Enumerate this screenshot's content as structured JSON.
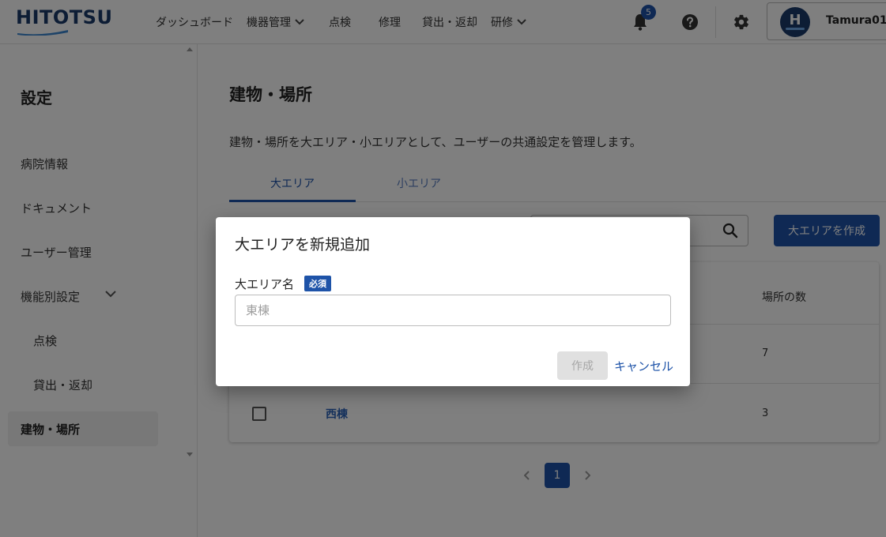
{
  "header": {
    "logo_text": "HITOTSU",
    "nav": [
      {
        "label": "ダッシュボード",
        "has_menu": false
      },
      {
        "label": "機器管理",
        "has_menu": true
      },
      {
        "label": "点検",
        "has_menu": false
      },
      {
        "label": "修理",
        "has_menu": false
      },
      {
        "label": "貸出・返却",
        "has_menu": false
      },
      {
        "label": "研修",
        "has_menu": true
      }
    ],
    "notification_count": "5",
    "user": {
      "avatar_letter": "H",
      "name": "Tamura01"
    },
    "icons": [
      "bell-icon",
      "help-icon",
      "gear-icon"
    ]
  },
  "sidebar": {
    "title": "設定",
    "items": [
      {
        "label": "病院情報"
      },
      {
        "label": "ドキュメント"
      },
      {
        "label": "ユーザー管理"
      },
      {
        "label": "機能別設定",
        "expanded": true
      },
      {
        "label": "点検",
        "sub": true
      },
      {
        "label": "貸出・返却",
        "sub": true
      },
      {
        "label": "建物・場所",
        "active": true
      }
    ]
  },
  "main": {
    "title": "建物・場所",
    "description": "建物・場所を大エリア・小エリアとして、ユーザーの共通設定を管理します。",
    "tabs": [
      {
        "label": "大エリア",
        "active": true
      },
      {
        "label": "小エリア",
        "active": false
      }
    ],
    "create_button": "大エリアを作成",
    "table": {
      "count_header": "場所の数",
      "rows": [
        {
          "name": "",
          "count": "7"
        },
        {
          "name": "西棟",
          "count": "3"
        }
      ]
    },
    "pagination": {
      "current": "1"
    }
  },
  "dialog": {
    "title": "大エリアを新規追加",
    "field_label": "大エリア名",
    "required_badge": "必須",
    "input_value": "",
    "input_placeholder": "東棟",
    "create_label": "作成",
    "cancel_label": "キャンセル"
  },
  "colors": {
    "primary": "#1e53a8",
    "logo": "#1a3a6b",
    "overlay": "rgba(0,0,0,0.5)"
  }
}
